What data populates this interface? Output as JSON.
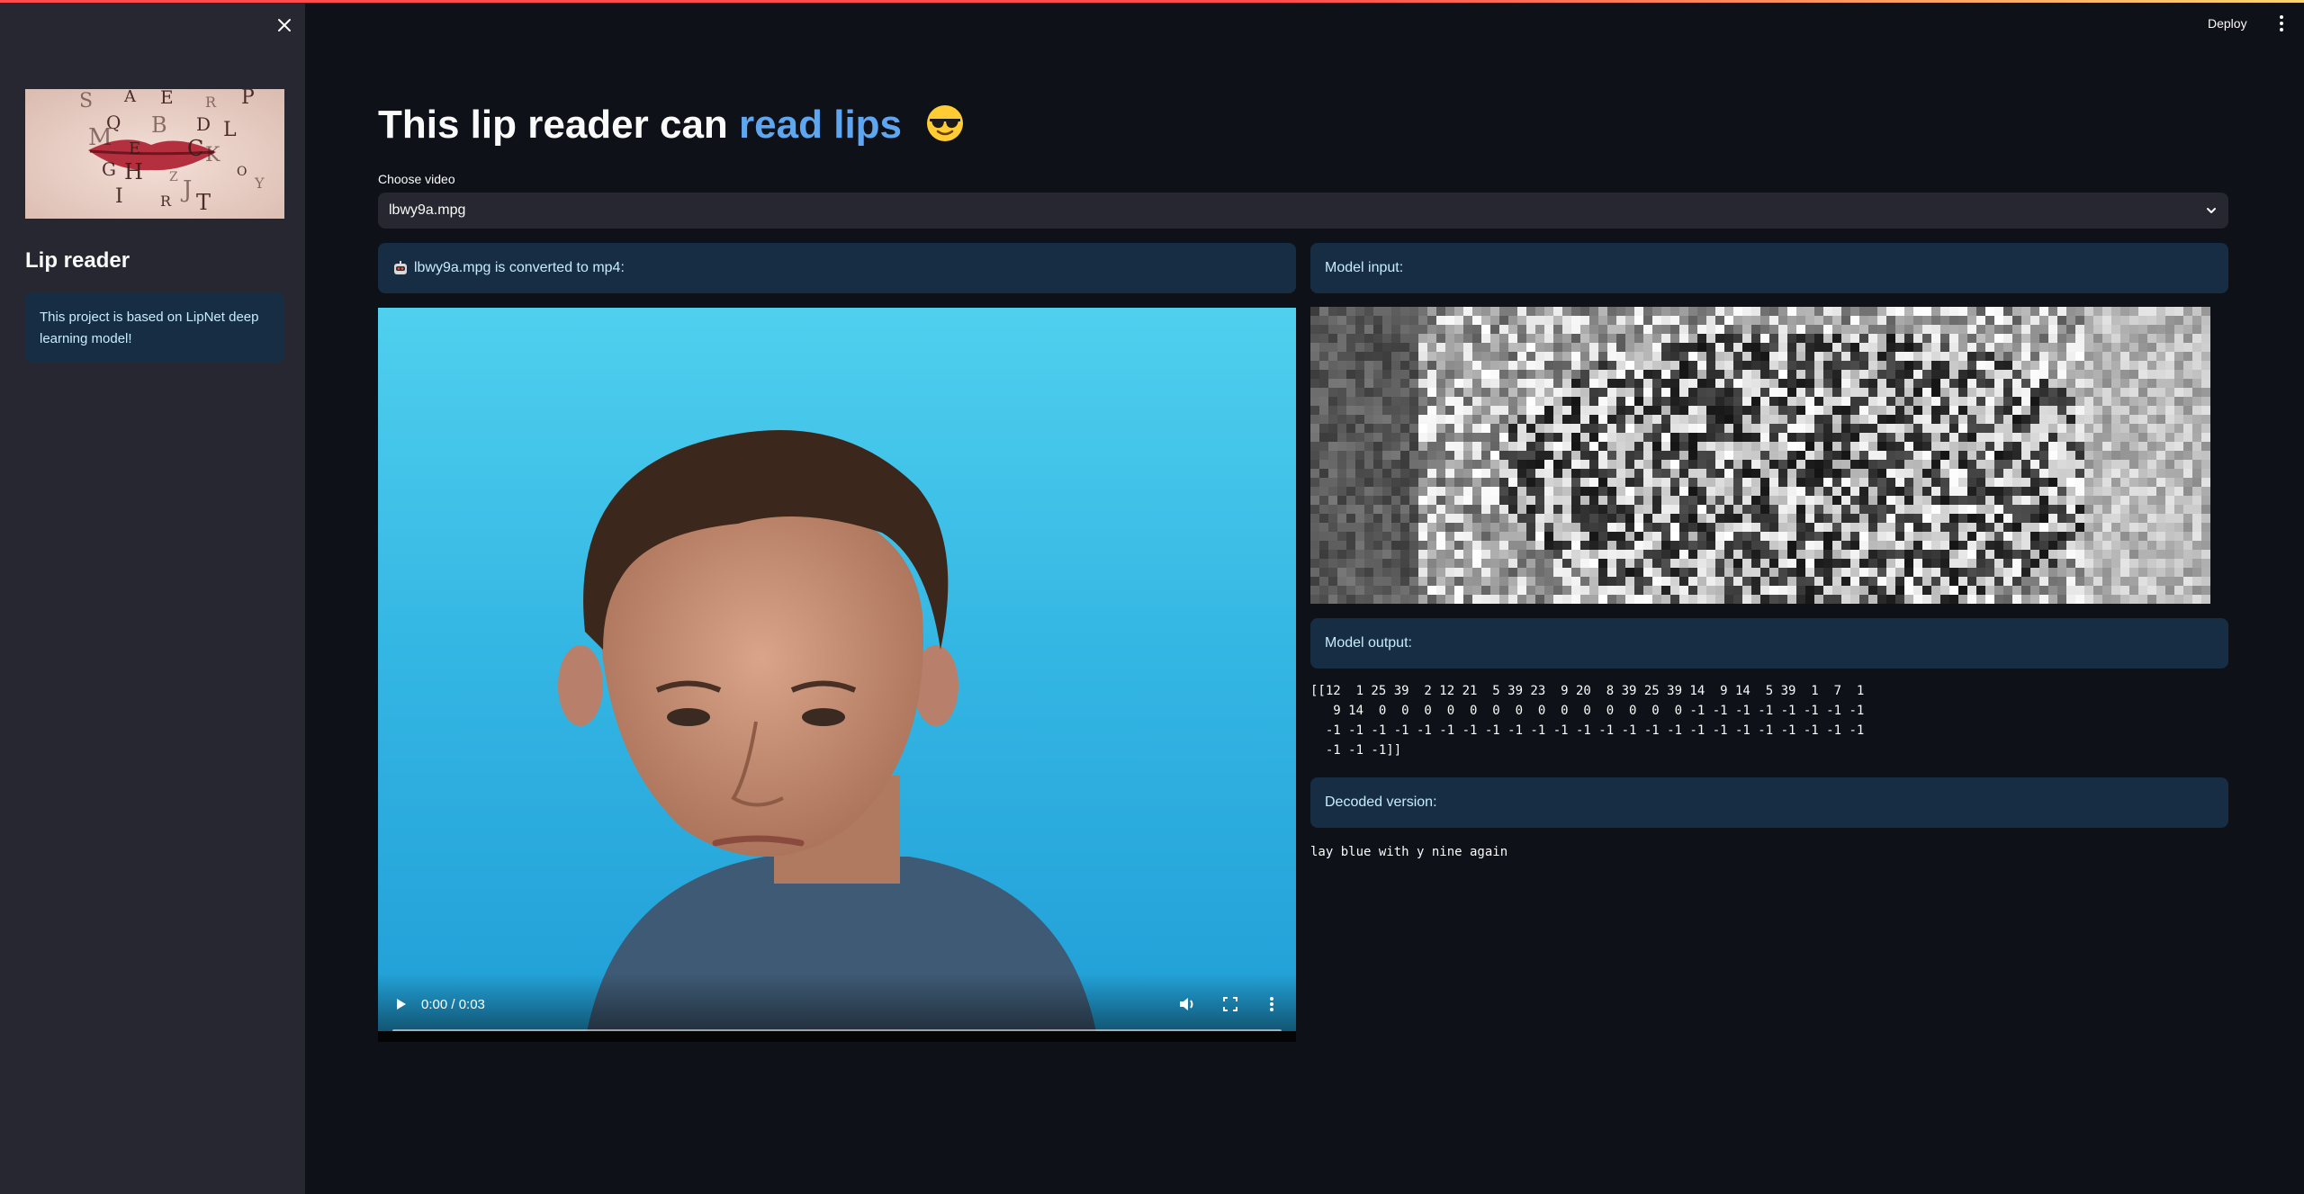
{
  "header": {
    "deploy_label": "Deploy",
    "menu_icon": "kebab-menu-icon"
  },
  "sidebar": {
    "close_icon": "close-icon",
    "image_letters": [
      "S",
      "A",
      "E",
      "R",
      "P",
      "Q",
      "B",
      "D",
      "L",
      "M",
      "E",
      "C",
      "K",
      "G",
      "H",
      "Z",
      "I",
      "R",
      "J",
      "T",
      "O",
      "Y"
    ],
    "title": "Lip reader",
    "info_text": "This project is based on LipNet deep learning model!"
  },
  "main": {
    "title_plain": "This lip reader can",
    "title_accent": "read lips",
    "title_emoji": "😎",
    "select_label": "Choose video",
    "select_value": "lbwy9a.mpg",
    "converted_info": "lbwy9a.mpg is converted to mp4:",
    "video": {
      "time": "0:00 / 0:03",
      "progress": 0
    },
    "model_input_label": "Model input:",
    "model_output_label": "Model output:",
    "model_output": "[[12  1 25 39  2 12 21  5 39 23  9 20  8 39 25 39 14  9 14  5 39  1  7  1\n   9 14  0  0  0  0  0  0  0  0  0  0  0  0  0  0 -1 -1 -1 -1 -1 -1 -1 -1\n  -1 -1 -1 -1 -1 -1 -1 -1 -1 -1 -1 -1 -1 -1 -1 -1 -1 -1 -1 -1 -1 -1 -1 -1\n  -1 -1 -1]]",
    "decoded_label": "Decoded version:",
    "decoded_text": "lay blue with y nine again"
  },
  "colors": {
    "background": "#0e1117",
    "sidebar": "#262730",
    "info_box": "#172d43",
    "info_text": "#c7ebff",
    "accent": "#5ea7f0"
  }
}
